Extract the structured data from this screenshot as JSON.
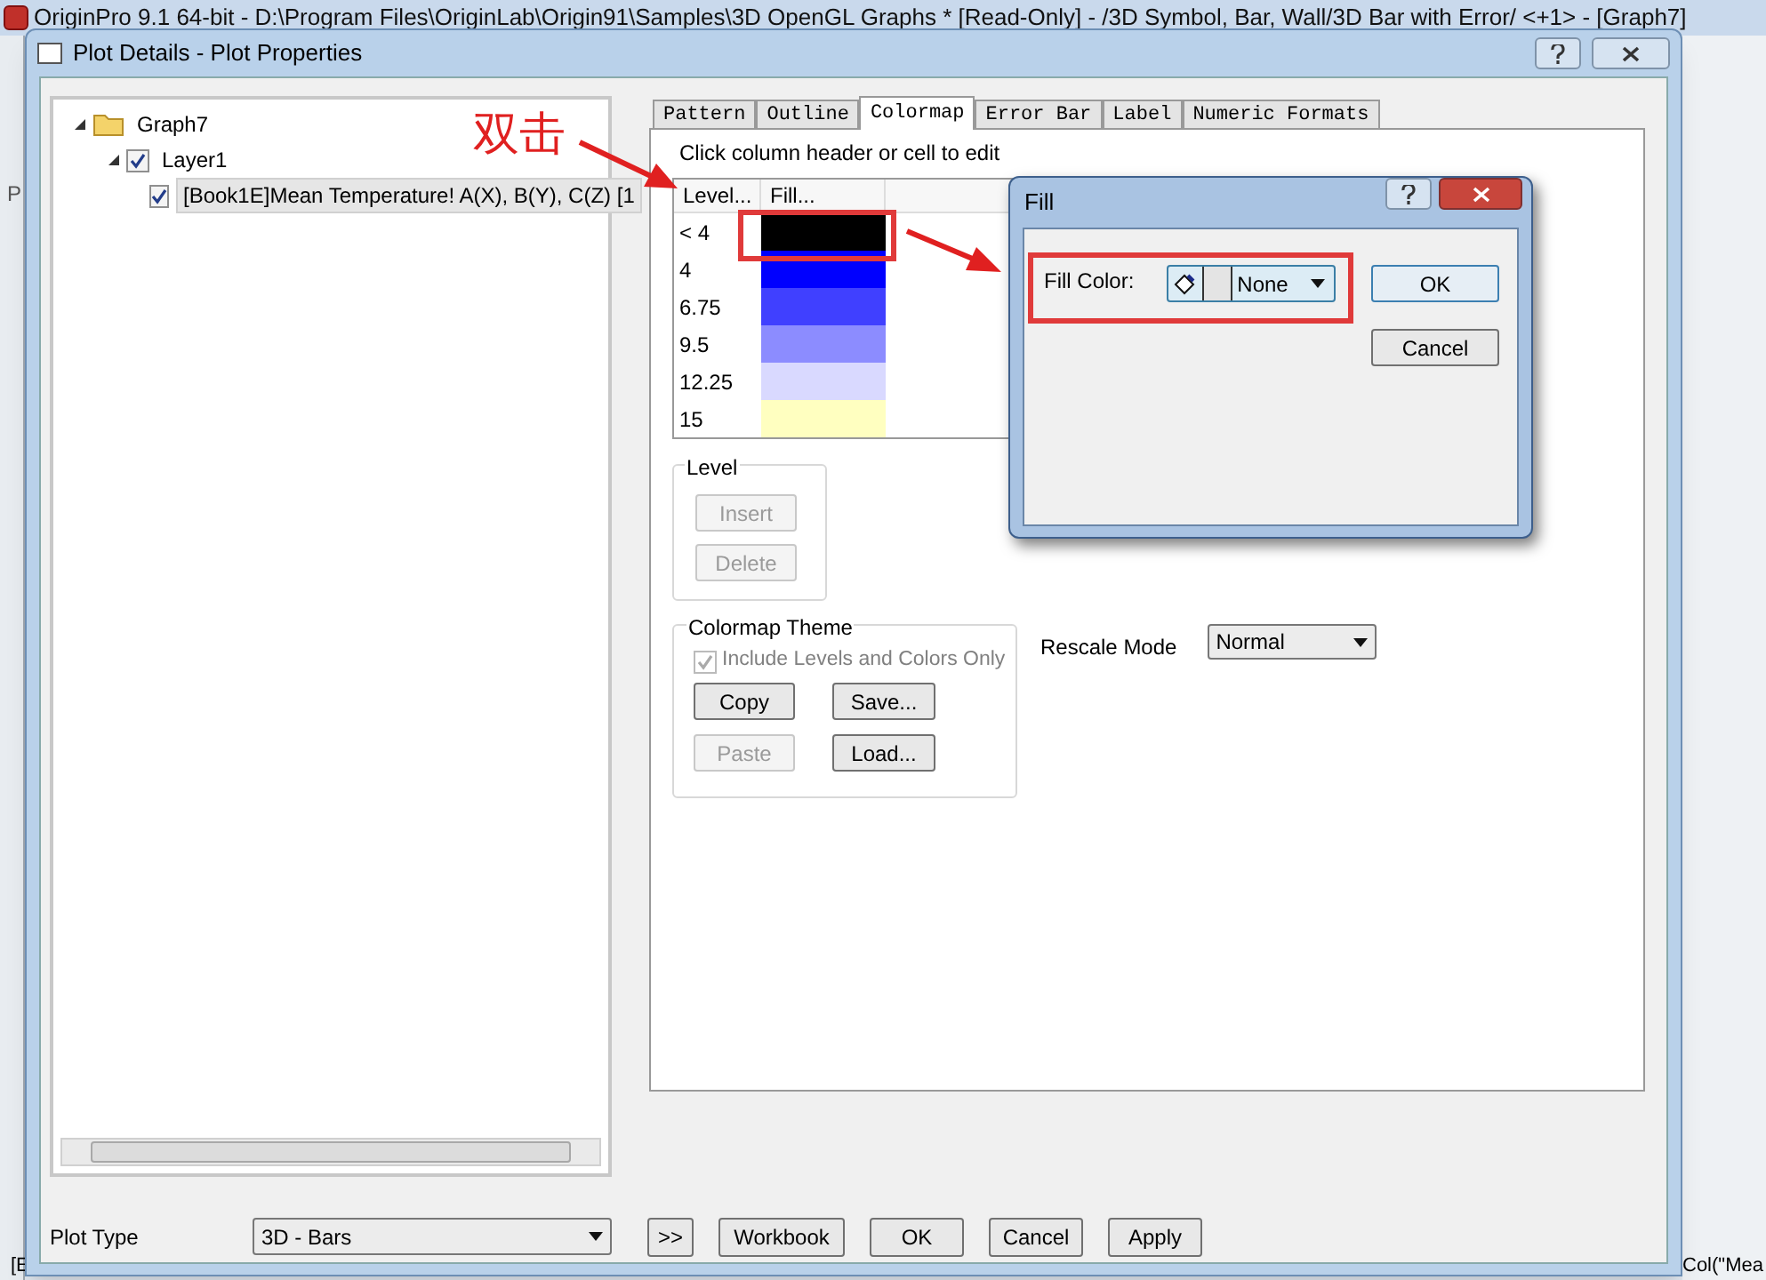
{
  "app_window": {
    "title": "OriginPro 9.1 64-bit - D:\\Program Files\\OriginLab\\Origin91\\Samples\\3D OpenGL Graphs * [Read-Only] - /3D Symbol, Bar, Wall/3D Bar with Error/ <+1> - [Graph7]",
    "left_text": "P",
    "status_left": "[E",
    "status_right": "Col(\"Mea"
  },
  "dialog": {
    "title": "Plot Details - Plot Properties",
    "tree": [
      {
        "label": "Graph7",
        "kind": "folder",
        "expanded": true,
        "children": [
          {
            "label": "Layer1",
            "kind": "check",
            "checked": true,
            "expanded": true,
            "children": [
              {
                "label": "[Book1E]Mean Temperature! A(X), B(Y), C(Z) [1",
                "kind": "check",
                "checked": true,
                "selected": true
              }
            ]
          }
        ]
      }
    ],
    "tabs": [
      {
        "label": "Pattern",
        "selected": false
      },
      {
        "label": "Outline",
        "selected": false
      },
      {
        "label": "Colormap",
        "selected": true
      },
      {
        "label": "Error Bar",
        "selected": false
      },
      {
        "label": "Label",
        "selected": false
      },
      {
        "label": "Numeric Formats",
        "selected": false
      }
    ],
    "colormap": {
      "hint": "Click column header or cell to edit",
      "columns": [
        "Level...",
        "Fill..."
      ],
      "rows": [
        {
          "level": "< 4",
          "color": "#000000"
        },
        {
          "level": "4",
          "color": "#0000ff"
        },
        {
          "level": "6.75",
          "color": "#4040ff"
        },
        {
          "level": "9.5",
          "color": "#8c8cff"
        },
        {
          "level": "12.25",
          "color": "#d9d9ff"
        },
        {
          "level": "15",
          "color": "#ffffc0"
        }
      ]
    },
    "level_group": {
      "title": "Level",
      "buttons": [
        {
          "label": "Insert",
          "disabled": true
        },
        {
          "label": "Delete",
          "disabled": true
        }
      ]
    },
    "theme_group": {
      "title": "Colormap Theme",
      "checkbox": {
        "label": "Include Levels and Colors Only",
        "checked": true,
        "disabled": true
      },
      "buttons": [
        {
          "label": "Copy",
          "disabled": false
        },
        {
          "label": "Save...",
          "disabled": false
        },
        {
          "label": "Paste",
          "disabled": true
        },
        {
          "label": "Load...",
          "disabled": false
        }
      ]
    },
    "rescale": {
      "label": "Rescale Mode",
      "value": "Normal"
    },
    "plot_type": {
      "label": "Plot Type",
      "value": "3D - Bars"
    },
    "footer_buttons": [
      ">>",
      "Workbook",
      "OK",
      "Cancel",
      "Apply"
    ]
  },
  "fill_dialog": {
    "title": "Fill",
    "label": "Fill Color:",
    "value": "None",
    "buttons": [
      "OK",
      "Cancel"
    ]
  },
  "annotation": {
    "text": "双击"
  }
}
